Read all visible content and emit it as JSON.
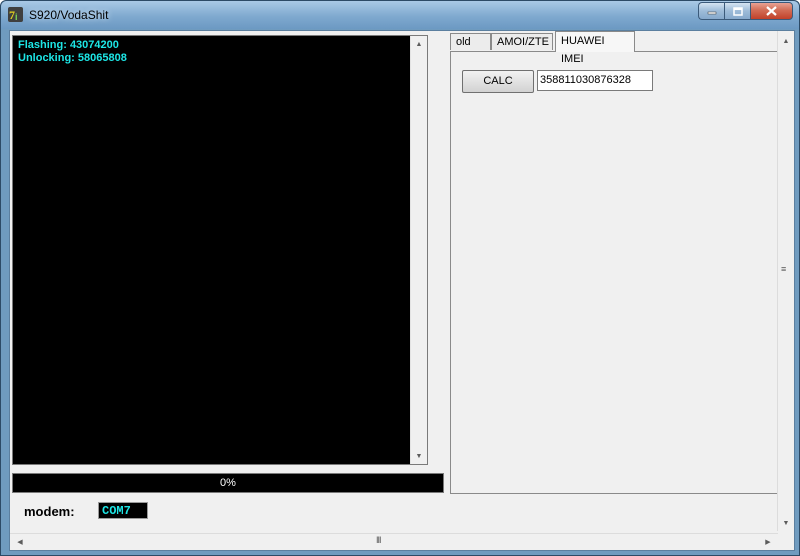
{
  "window": {
    "title": "S920/VodaShit",
    "icon": "app-icon",
    "controls": {
      "minimize_icon": "minimize-icon",
      "maximize_icon": "maximize-icon",
      "close_icon": "close-icon"
    }
  },
  "log": {
    "lines": [
      "Flashing: 43074200",
      "Unlocking: 58065808"
    ],
    "text_color": "#1de6e6",
    "background": "#000000"
  },
  "progress": {
    "label": "0%",
    "value": 0
  },
  "modem": {
    "label": "modem:",
    "value": "COM7"
  },
  "tabs": [
    {
      "label": "old",
      "active": false
    },
    {
      "label": "AMOI/ZTE",
      "active": false
    },
    {
      "label": "HUAWEI IMEI",
      "active": true
    }
  ],
  "huawei_panel": {
    "calc_label": "CALC",
    "imei_value": "358811030876328"
  },
  "hscroll_grip": "III",
  "vscroll_grip": "≡"
}
